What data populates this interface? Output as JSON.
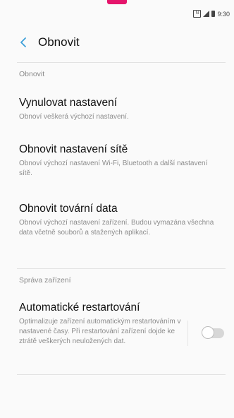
{
  "status_bar": {
    "time": "9:30",
    "nfc_label": "N"
  },
  "header": {
    "title": "Obnovit"
  },
  "sections": {
    "reset": "Obnovit",
    "device": "Správa zařízení"
  },
  "items": [
    {
      "title": "Vynulovat nastavení",
      "desc": "Obnoví veškerá výchozí nastavení."
    },
    {
      "title": "Obnovit nastavení sítě",
      "desc": "Obnoví výchozí nastavení Wi-Fi, Bluetooth a další nastavení sítě."
    },
    {
      "title": "Obnovit tovární data",
      "desc": "Obnoví výchozí nastavení zařízení. Budou vymazána všechna data včetně souborů a stažených aplikací."
    },
    {
      "title": "Automatické restartování",
      "desc": "Optimalizuje zařízení automatickým restartováním v nastavené časy. Při restartování zařízení dojde ke ztrátě veškerých neuložených dat.",
      "toggle_on": false
    }
  ],
  "colors": {
    "accent": "#e5156b",
    "back_arrow": "#3d9fd8"
  },
  "icons": {
    "back": "chevron-left-icon"
  }
}
